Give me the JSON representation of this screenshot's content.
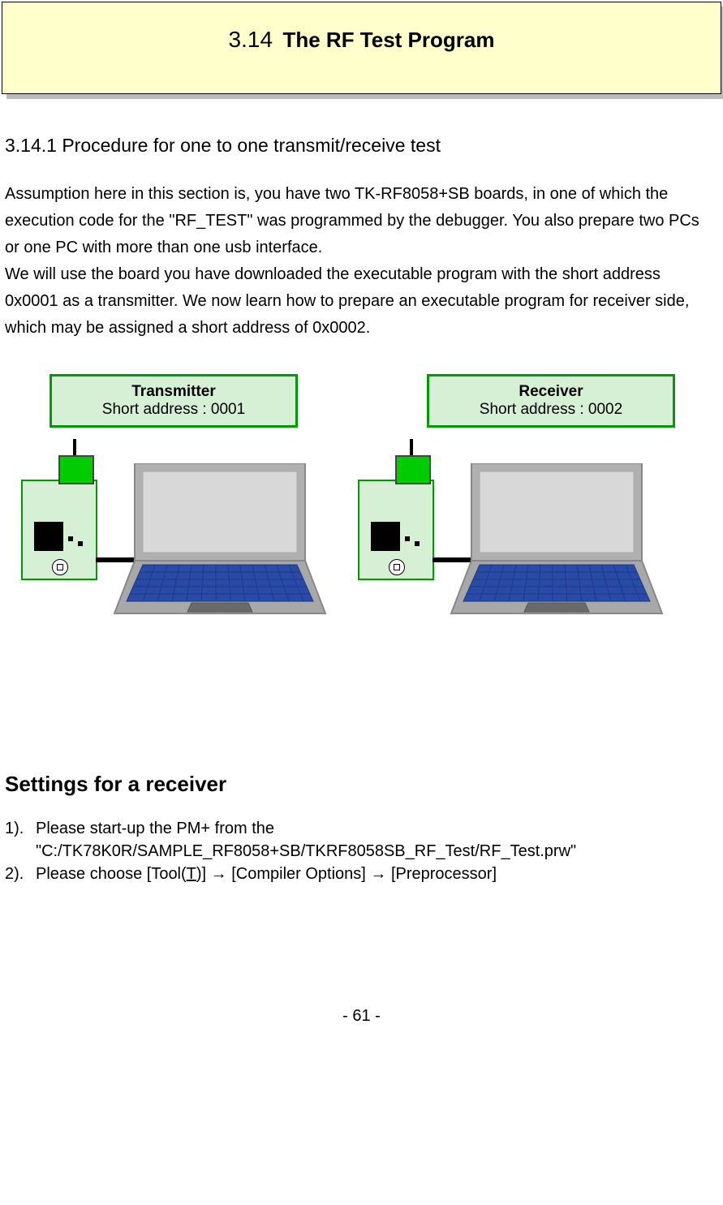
{
  "banner": {
    "number": "3.14",
    "title": "The RF Test Program"
  },
  "subsection_title": "3.14.1 Procedure for one to one transmit/receive test",
  "paragraph1": "Assumption here in this section is, you have two TK-RF8058+SB boards, in one of which the execution code for the \"RF_TEST\" was programmed by the debugger. You also prepare two PCs or one PC with more than one usb interface.",
  "paragraph2": "We will use the board you have downloaded the executable program with the short address 0x0001 as a transmitter. We now learn how to prepare an executable program for receiver side, which may be assigned a short address of 0x0002.",
  "labels": {
    "tx": {
      "title": "Transmitter",
      "addr": "Short address : 0001"
    },
    "rx": {
      "title": "Receiver",
      "addr": "Short address : 0002"
    }
  },
  "settings": {
    "title": "Settings for a receiver",
    "steps": [
      {
        "num": "1).",
        "text_a": "Please start-up the PM+ from the",
        "text_b": "\"C:/TK78K0R/SAMPLE_RF8058+SB/TKRF8058SB_RF_Test/RF_Test.prw\""
      },
      {
        "num": "2).",
        "text_a": "Please choose [Tool(",
        "underlined": "T",
        "text_after": ")] → [Compiler Options] → [Preprocessor]"
      }
    ]
  },
  "page_number": "- 61 -"
}
